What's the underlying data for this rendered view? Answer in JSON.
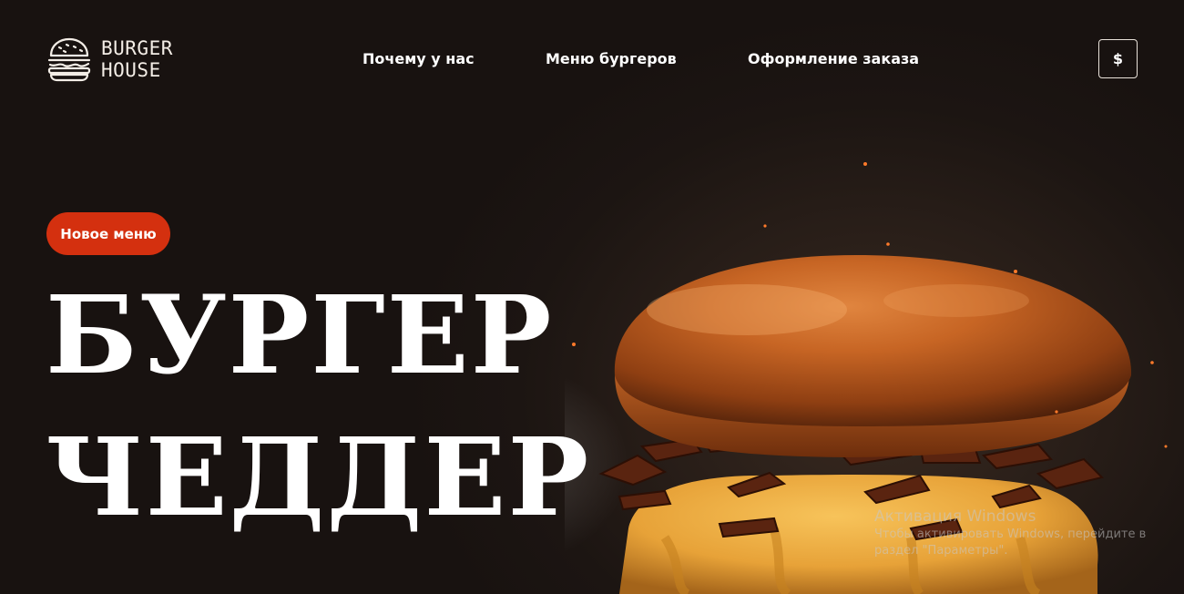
{
  "header": {
    "logo": {
      "icon": "burger-icon",
      "line1": "BURGER",
      "line2": "HOUSE"
    },
    "nav": [
      {
        "label": "Почему у нас"
      },
      {
        "label": "Меню бургеров"
      },
      {
        "label": "Оформление заказа"
      }
    ],
    "currency_button": "$"
  },
  "hero": {
    "badge": "Новое меню",
    "title_line1": "БУРГЕР",
    "title_line2": "ЧЕДДЕР",
    "image": "cheddar-burger-photo"
  },
  "watermark": {
    "title": "Активация Windows",
    "subtitle": "Чтобы активировать Windows, перейдите в раздел \"Параметры\"."
  },
  "colors": {
    "background": "#1a1412",
    "badge": "#d4300f",
    "text": "#ffffff"
  }
}
